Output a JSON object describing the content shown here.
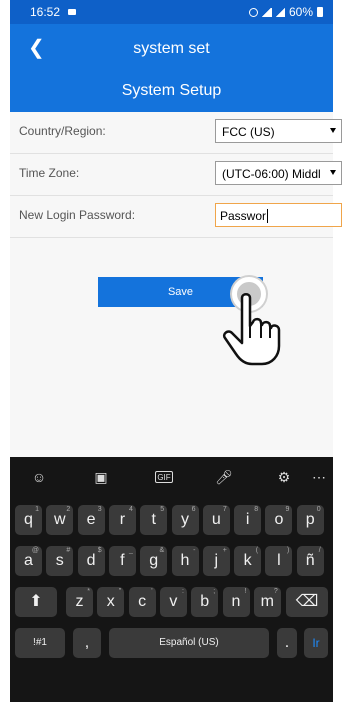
{
  "status": {
    "time": "16:52",
    "battery": "60%"
  },
  "appbar": {
    "title": "system set",
    "subtitle": "System Setup",
    "back_glyph": "❮"
  },
  "form": {
    "country_label": "Country/Region:",
    "country_value": "FCC (US)",
    "timezone_label": "Time Zone:",
    "timezone_value": "(UTC-06:00) Middl",
    "password_label": "New Login Password:",
    "password_value": "Passwor"
  },
  "save_label": "Save",
  "keyboard": {
    "row1": [
      {
        "k": "q",
        "s": "1"
      },
      {
        "k": "w",
        "s": "2"
      },
      {
        "k": "e",
        "s": "3"
      },
      {
        "k": "r",
        "s": "4"
      },
      {
        "k": "t",
        "s": "5"
      },
      {
        "k": "y",
        "s": "6"
      },
      {
        "k": "u",
        "s": "7"
      },
      {
        "k": "i",
        "s": "8"
      },
      {
        "k": "o",
        "s": "9"
      },
      {
        "k": "p",
        "s": "0"
      }
    ],
    "row2": [
      {
        "k": "a",
        "s": "@"
      },
      {
        "k": "s",
        "s": "#"
      },
      {
        "k": "d",
        "s": "$"
      },
      {
        "k": "f",
        "s": "_"
      },
      {
        "k": "g",
        "s": "&"
      },
      {
        "k": "h",
        "s": "-"
      },
      {
        "k": "j",
        "s": "+"
      },
      {
        "k": "k",
        "s": "("
      },
      {
        "k": "l",
        "s": ")"
      },
      {
        "k": "ñ",
        "s": "/"
      }
    ],
    "row3": [
      {
        "k": "z",
        "s": "*"
      },
      {
        "k": "x",
        "s": "\""
      },
      {
        "k": "c",
        "s": "'"
      },
      {
        "k": "v",
        "s": ":"
      },
      {
        "k": "b",
        "s": ";"
      },
      {
        "k": "n",
        "s": "!"
      },
      {
        "k": "m",
        "s": "?"
      }
    ],
    "symbols": "!#1",
    "comma": ",",
    "space": "Español (US)",
    "period": ".",
    "go": "Ir",
    "shift": "⬆",
    "backspace": "⌫"
  }
}
